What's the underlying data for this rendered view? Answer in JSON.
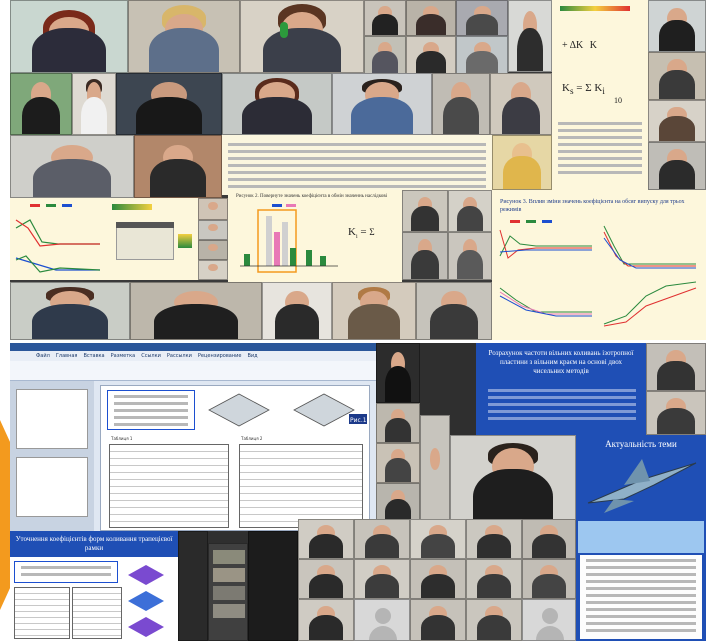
{
  "collage": {
    "description_free": true,
    "colors": {
      "slide_blue": "#1f4fb5",
      "slide_cream": "#fdf7dc",
      "accent_orange": "#f39a1e",
      "word_blue": "#2b579a"
    }
  },
  "slides": {
    "left_formula_text": "Рисунок 2. Повернуте значень коефіцієнта в обмін значеннь наслідкові",
    "right_caption": "Рисунок 3. Вплив зміни значень коефіцієнта на обсяг випуску для трьох режимів",
    "formula_right_1": "+ ΔK",
    "formula_right_2": "K",
    "formula_right_3": "10",
    "formula_center_k": "K",
    "blue_slide_title": "Розрахунок частоти вільних коливань ізотропної пластини з вільним краєм на основі двох чисельних методів",
    "actuality_title": "Актуальність теми",
    "bottom_left_title": "Уточнення коефіцієнтів форм коливання трапецієвої рамки",
    "word_fig_label": "Рис.1"
  },
  "word": {
    "menu_items": [
      "Файл",
      "Главная",
      "Вставка",
      "Разметка",
      "Ссылки",
      "Рассылки",
      "Рецензирование",
      "Вид"
    ],
    "table_title_1": "Таблиця 1",
    "table_title_2": "Таблиця 2"
  }
}
